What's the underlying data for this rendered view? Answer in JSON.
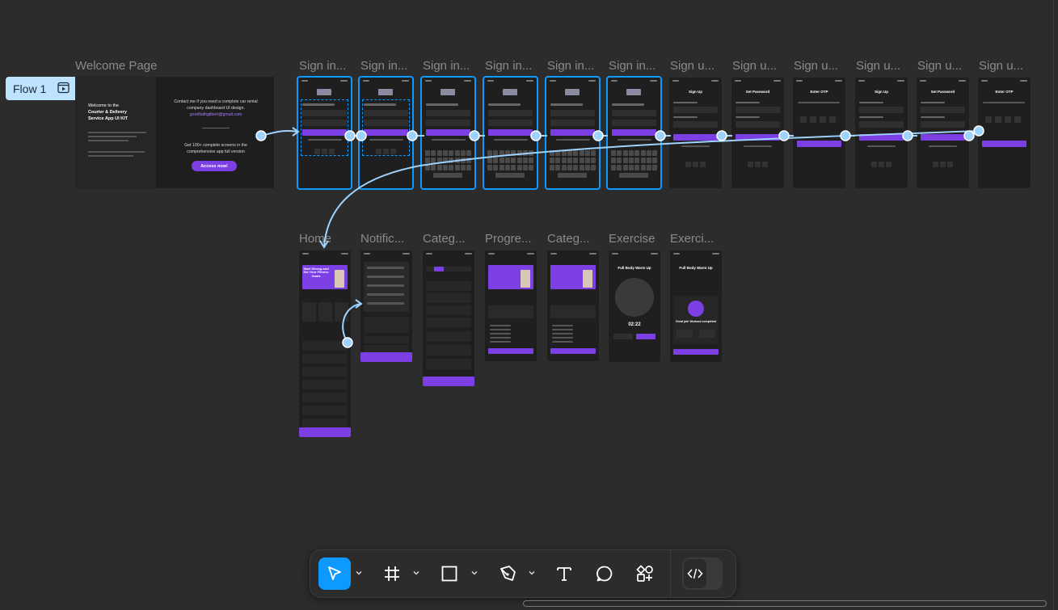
{
  "canvas": {
    "flow_label": "Flow 1",
    "welcome": {
      "label": "Welcome Page",
      "left_title_1": "Welcome to the",
      "left_title_2": "Courier & Delivery",
      "left_title_3": "Service App UI KIT",
      "right_line_1": "Contact me if you need a complete car rental",
      "right_line_2": "company dashboard UI design.",
      "right_email": "goodfaithgilbert@gmail.com",
      "right_line_3": "Get 100+ complete screens in the",
      "right_line_4": "comprehensive app full version",
      "cta": "Access now!"
    },
    "row1_labels": [
      "Sign in...",
      "Sign in...",
      "Sign in...",
      "Sign in...",
      "Sign in...",
      "Sign in...",
      "Sign u...",
      "Sign u...",
      "Sign u...",
      "Sign u...",
      "Sign u...",
      "Sign u..."
    ],
    "row2_labels": [
      "Home",
      "Notific...",
      "Categ...",
      "Progre...",
      "Categ...",
      "Exercise",
      "Exerci..."
    ],
    "screen_texts": {
      "sign_up": "Sign Up",
      "set_password": "Set Password",
      "enter_otp": "Enter OTP",
      "home_hero": "Start Strong and Set Your Fitness Goals",
      "warm_up": "Full Body Warm Up",
      "timer": "02:22",
      "completed": "Great job! Workout completed"
    }
  },
  "toolbar": {
    "tools": [
      "move-tool",
      "frame-tool",
      "shape-tool",
      "pen-tool",
      "text-tool",
      "comment-tool",
      "actions-tool",
      "dev-mode-toggle"
    ],
    "accent": "#0d99ff"
  },
  "colors": {
    "canvas": "#2c2c2c",
    "purple": "#7b3fe4",
    "connector": "#9fd3ff",
    "selection": "#0d99ff"
  }
}
